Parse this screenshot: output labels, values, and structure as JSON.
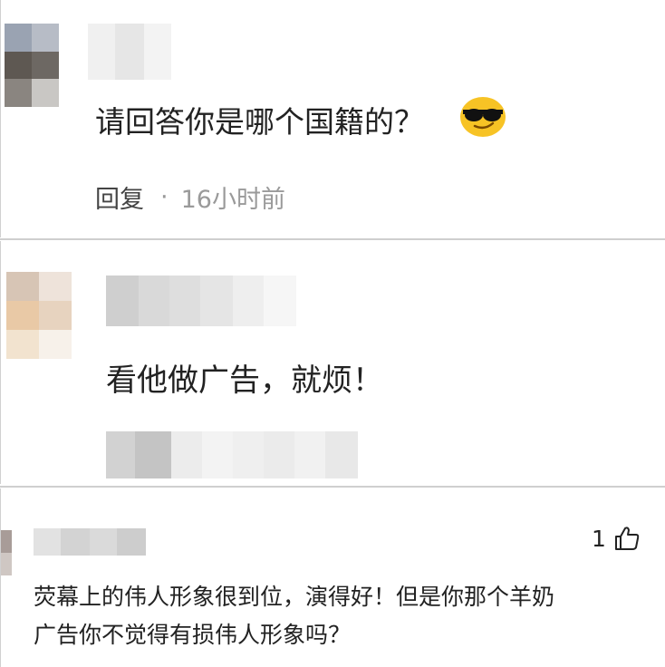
{
  "comments": [
    {
      "text": "请回答你是哪个国籍的？",
      "emoji": "sunglasses-emoji",
      "reply_label": "回复",
      "separator": "·",
      "time": "16小时前"
    },
    {
      "text": "看他做广告，就烦！"
    },
    {
      "like_count": "1",
      "text_line1": "荧幕上的伟人形象很到位，演得好！但是你那个羊奶",
      "text_line2": "广告你不觉得有损伟人形象吗？"
    }
  ],
  "colors": {
    "emoji_face": "#f7c325",
    "divider": "#cfcfcf",
    "meta_text": "#9a9a9a"
  }
}
